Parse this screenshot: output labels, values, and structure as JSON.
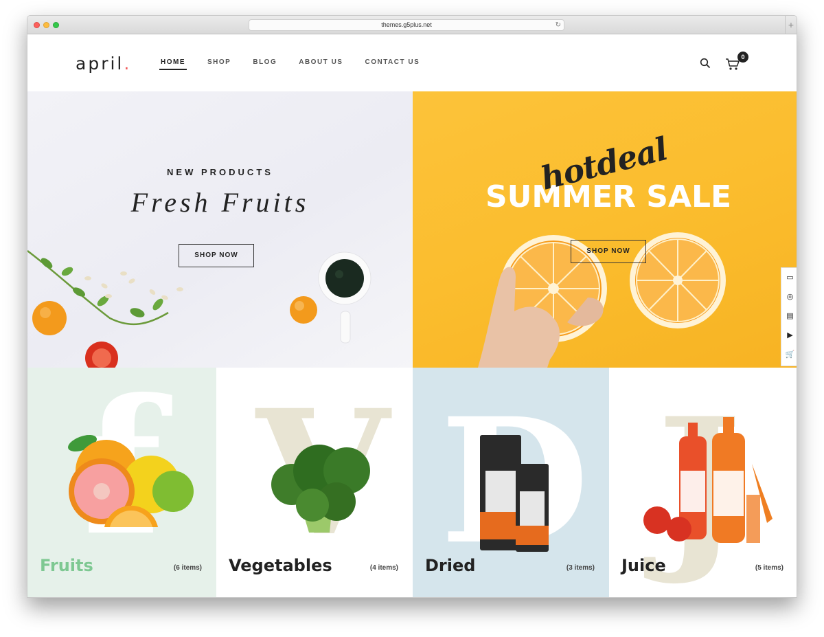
{
  "browser": {
    "url": "themes.g5plus.net",
    "new_tab_label": "+"
  },
  "header": {
    "logo": "april",
    "logo_dot": ".",
    "nav": [
      {
        "label": "HOME",
        "active": true
      },
      {
        "label": "SHOP",
        "active": false
      },
      {
        "label": "BLOG",
        "active": false
      },
      {
        "label": "ABOUT US",
        "active": false
      },
      {
        "label": "CONTACT US",
        "active": false
      }
    ],
    "cart_count": "0"
  },
  "hero_left": {
    "eyebrow": "NEW PRODUCTS",
    "headline": "Fresh Fruits",
    "button": "SHOP NOW"
  },
  "hero_right": {
    "script_text": "hotdeal",
    "headline": "SUMMER SALE",
    "button": "SHOP NOW"
  },
  "side_tools": [
    "desktop-icon",
    "support-icon",
    "document-icon",
    "play-icon",
    "cart-icon"
  ],
  "categories": [
    {
      "name": "Fruits",
      "count": "(6 items)",
      "letter": "f",
      "bg": "#e6f1ea",
      "name_color": "#7ec892"
    },
    {
      "name": "Vegetables",
      "count": "(4 items)",
      "letter": "V",
      "bg": "#ffffff",
      "name_color": "#222222"
    },
    {
      "name": "Dried",
      "count": "(3 items)",
      "letter": "D",
      "bg": "#d5e5ec",
      "name_color": "#222222"
    },
    {
      "name": "Juice",
      "count": "(5 items)",
      "letter": "J",
      "bg": "#ffffff",
      "name_color": "#222222"
    }
  ],
  "colors": {
    "accent_red": "#f05a5a",
    "hero_yellow": "#fbbd2e",
    "text_dark": "#222222"
  }
}
